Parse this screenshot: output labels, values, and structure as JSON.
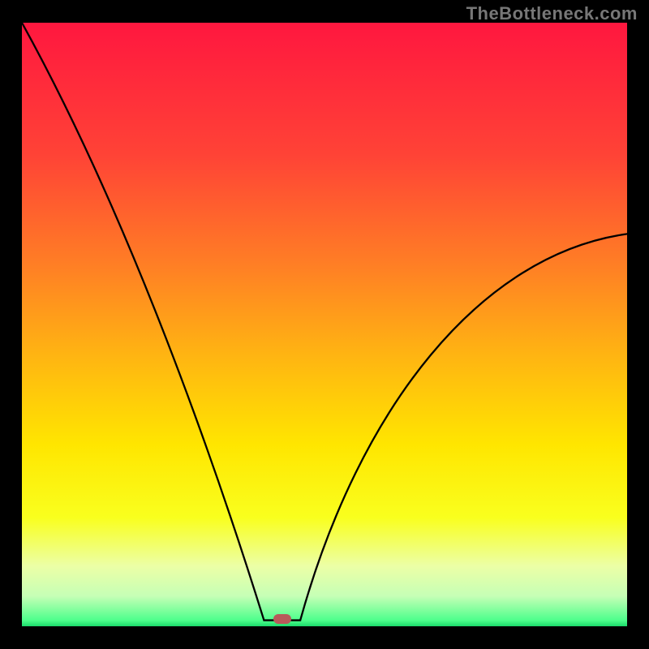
{
  "header": {
    "source": "TheBottleneck.com"
  },
  "chart_data": {
    "type": "line",
    "title": "",
    "xlabel": "",
    "ylabel": "",
    "ylim": [
      0,
      100
    ],
    "xlim": [
      0,
      100
    ],
    "curve_vertex_x": 43,
    "curve_vertex_y": 1,
    "gradient_stops": [
      {
        "offset": 0.0,
        "color": "#ff173f"
      },
      {
        "offset": 0.22,
        "color": "#ff4336"
      },
      {
        "offset": 0.4,
        "color": "#ff7e25"
      },
      {
        "offset": 0.55,
        "color": "#ffb412"
      },
      {
        "offset": 0.7,
        "color": "#ffe600"
      },
      {
        "offset": 0.82,
        "color": "#f9ff1e"
      },
      {
        "offset": 0.9,
        "color": "#ecffa6"
      },
      {
        "offset": 0.95,
        "color": "#c6ffb6"
      },
      {
        "offset": 0.99,
        "color": "#4eff8c"
      },
      {
        "offset": 1.0,
        "color": "#1bdb6b"
      }
    ],
    "left_curve_start": {
      "x": 0,
      "y": 100
    },
    "right_curve_end": {
      "x": 100,
      "y": 65
    },
    "marker": {
      "x": 43,
      "y": 1.2,
      "color": "#b85a5a"
    }
  }
}
